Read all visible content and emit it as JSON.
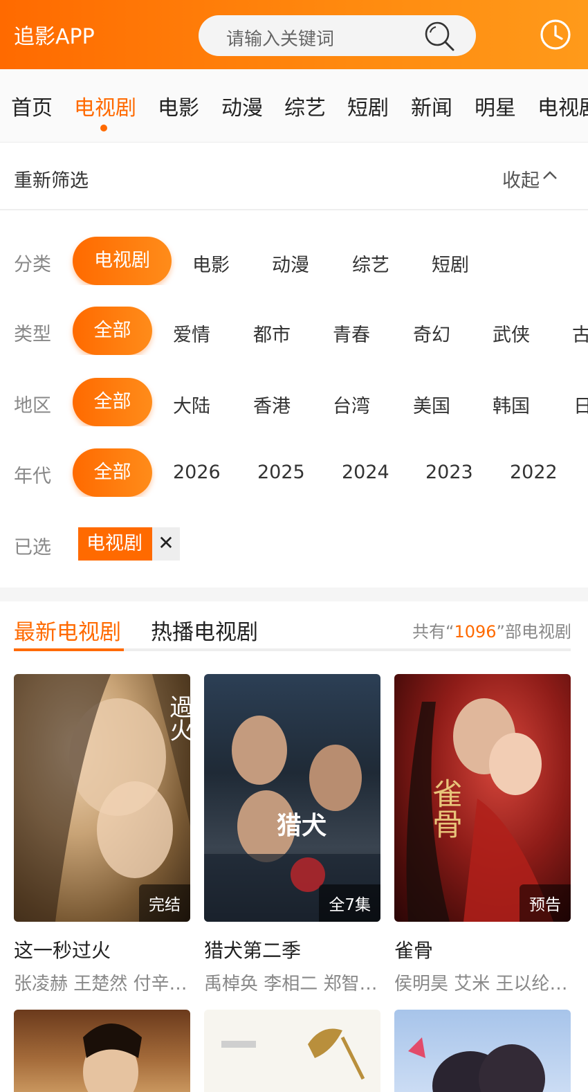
{
  "header": {
    "brand": "追影APP",
    "search_placeholder": "请输入关键词"
  },
  "nav": {
    "items": [
      "首页",
      "电视剧",
      "电影",
      "动漫",
      "综艺",
      "短剧",
      "新闻",
      "明星",
      "电视剧"
    ],
    "active_index": 1
  },
  "filter": {
    "title": "重新筛选",
    "collapse": "收起"
  },
  "rows": {
    "category": {
      "label": "分类",
      "options": [
        "电视剧",
        "电影",
        "动漫",
        "综艺",
        "短剧"
      ]
    },
    "genre": {
      "label": "类型",
      "options": [
        "全部",
        "爱情",
        "都市",
        "青春",
        "奇幻",
        "武侠",
        "古"
      ]
    },
    "region": {
      "label": "地区",
      "options": [
        "全部",
        "大陆",
        "香港",
        "台湾",
        "美国",
        "韩国",
        "日"
      ]
    },
    "year": {
      "label": "年代",
      "options": [
        "全部",
        "2026",
        "2025",
        "2024",
        "2023",
        "2022"
      ]
    }
  },
  "selected": {
    "label": "已选",
    "tag": "电视剧",
    "close": "✕"
  },
  "list": {
    "tabs": [
      "最新电视剧",
      "热播电视剧"
    ],
    "total_prefix": "共有“",
    "total_count": "1096",
    "total_suffix": "”部电视剧"
  },
  "cards": [
    {
      "title": "这一秒过火",
      "cast": "张凌赫 王楚然 付辛博 付辛博",
      "badge": "完结",
      "poster_text": "過火"
    },
    {
      "title": "猎犬第二季",
      "cast": "禹棹奂 李相二 郑智薰 金",
      "badge": "全7集",
      "poster_text": "猎犬"
    },
    {
      "title": "雀骨",
      "cast": "侯明昊 艾米 王以纶 ...",
      "badge": "预告",
      "poster_text": "雀骨"
    }
  ],
  "colors": {
    "accent": "#ff6a00",
    "muted": "#888888"
  }
}
